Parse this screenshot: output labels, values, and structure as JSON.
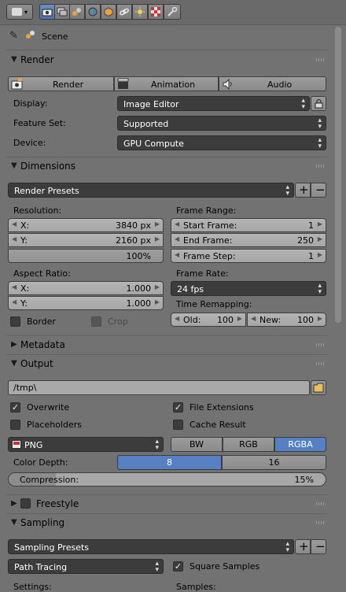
{
  "header": {
    "editor_type_icon": "properties-editor-icon",
    "tabs": [
      {
        "name": "render-tab",
        "icon": "camera-icon",
        "active": true
      },
      {
        "name": "render-layers-tab",
        "icon": "layers-icon",
        "active": false
      },
      {
        "name": "scene-tab",
        "icon": "scene-icon",
        "active": false
      },
      {
        "name": "world-tab",
        "icon": "world-icon",
        "active": false
      },
      {
        "name": "object-tab",
        "icon": "cube-icon",
        "active": false
      },
      {
        "name": "constraints-tab",
        "icon": "chain-icon",
        "active": false
      },
      {
        "name": "light-tab",
        "icon": "sun-icon",
        "active": false
      },
      {
        "name": "texture-tab",
        "icon": "checker-icon",
        "active": false
      },
      {
        "name": "physics-tab",
        "icon": "wrench-icon",
        "active": false
      }
    ]
  },
  "context": {
    "scene_label": "Scene"
  },
  "render_panel": {
    "title": "Render",
    "buttons": {
      "render": "Render",
      "animation": "Animation",
      "audio": "Audio"
    },
    "display_label": "Display:",
    "display_value": "Image Editor",
    "feature_set_label": "Feature Set:",
    "feature_set_value": "Supported",
    "device_label": "Device:",
    "device_value": "GPU Compute"
  },
  "dimensions_panel": {
    "title": "Dimensions",
    "presets": "Render Presets",
    "resolution_label": "Resolution:",
    "res_x_label": "X:",
    "res_x_value": "3840 px",
    "res_y_label": "Y:",
    "res_y_value": "2160 px",
    "res_percent": "100%",
    "aspect_label": "Aspect Ratio:",
    "aspect_x_label": "X:",
    "aspect_x_value": "1.000",
    "aspect_y_label": "Y:",
    "aspect_y_value": "1.000",
    "border_label": "Border",
    "crop_label": "Crop",
    "frame_range_label": "Frame Range:",
    "start_label": "Start Frame:",
    "start_value": "1",
    "end_label": "End Frame:",
    "end_value": "250",
    "step_label": "Frame Step:",
    "step_value": "1",
    "frame_rate_label": "Frame Rate:",
    "frame_rate_value": "24 fps",
    "remap_label": "Time Remapping:",
    "old_label": "Old:",
    "old_value": "100",
    "new_label": "New:",
    "new_value": "100"
  },
  "metadata_panel": {
    "title": "Metadata"
  },
  "output_panel": {
    "title": "Output",
    "path": "/tmp\\",
    "overwrite": "Overwrite",
    "file_extensions": "File Extensions",
    "placeholders": "Placeholders",
    "cache_result": "Cache Result",
    "format": "PNG",
    "color_modes": [
      "BW",
      "RGB",
      "RGBA"
    ],
    "color_mode_active": "RGBA",
    "color_depth_label": "Color Depth:",
    "depth_options": [
      "8",
      "16"
    ],
    "depth_active": "8",
    "compression_label": "Compression:",
    "compression_value": "15%",
    "compression_fraction": 0.15
  },
  "freestyle_panel": {
    "title": "Freestyle"
  },
  "sampling_panel": {
    "title": "Sampling",
    "presets": "Sampling Presets",
    "integrator": "Path Tracing",
    "square_samples": "Square Samples",
    "settings_label": "Settings:",
    "samples_label": "Samples:"
  },
  "colors": {
    "accent": "#5680c2",
    "panel_bg": "#727272",
    "dark_field": "#3c3c3c"
  }
}
